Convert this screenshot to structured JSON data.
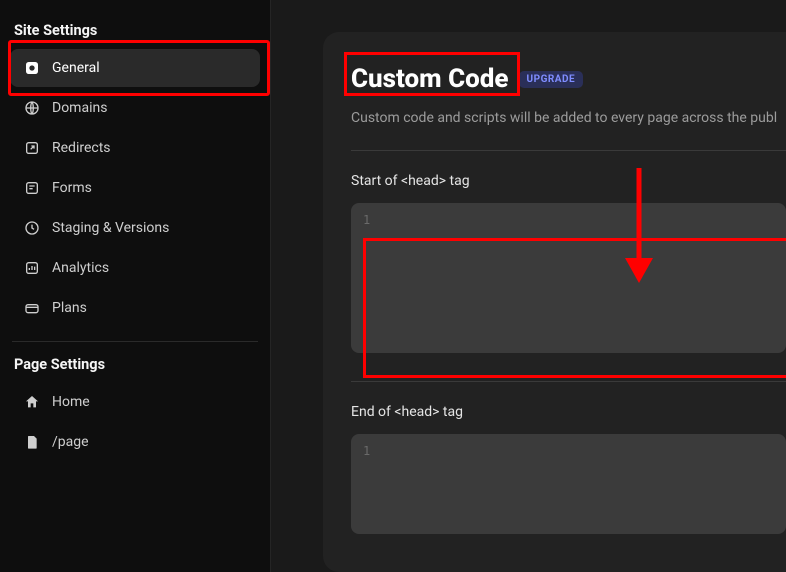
{
  "sidebar": {
    "site_settings_title": "Site Settings",
    "page_settings_title": "Page Settings",
    "items": [
      {
        "label": "General",
        "icon": "gear"
      },
      {
        "label": "Domains",
        "icon": "globe"
      },
      {
        "label": "Redirects",
        "icon": "arrow-out"
      },
      {
        "label": "Forms",
        "icon": "form"
      },
      {
        "label": "Staging & Versions",
        "icon": "clock"
      },
      {
        "label": "Analytics",
        "icon": "chart"
      },
      {
        "label": "Plans",
        "icon": "card"
      }
    ],
    "page_items": [
      {
        "label": "Home",
        "icon": "home"
      },
      {
        "label": "/page",
        "icon": "file"
      }
    ]
  },
  "main": {
    "title": "Custom Code",
    "upgrade_label": "UPGRADE",
    "subtitle": "Custom code and scripts will be added to every page across the publ",
    "head_start_label": "Start of <head> tag",
    "head_end_label": "End of <head> tag",
    "line_number": "1"
  }
}
